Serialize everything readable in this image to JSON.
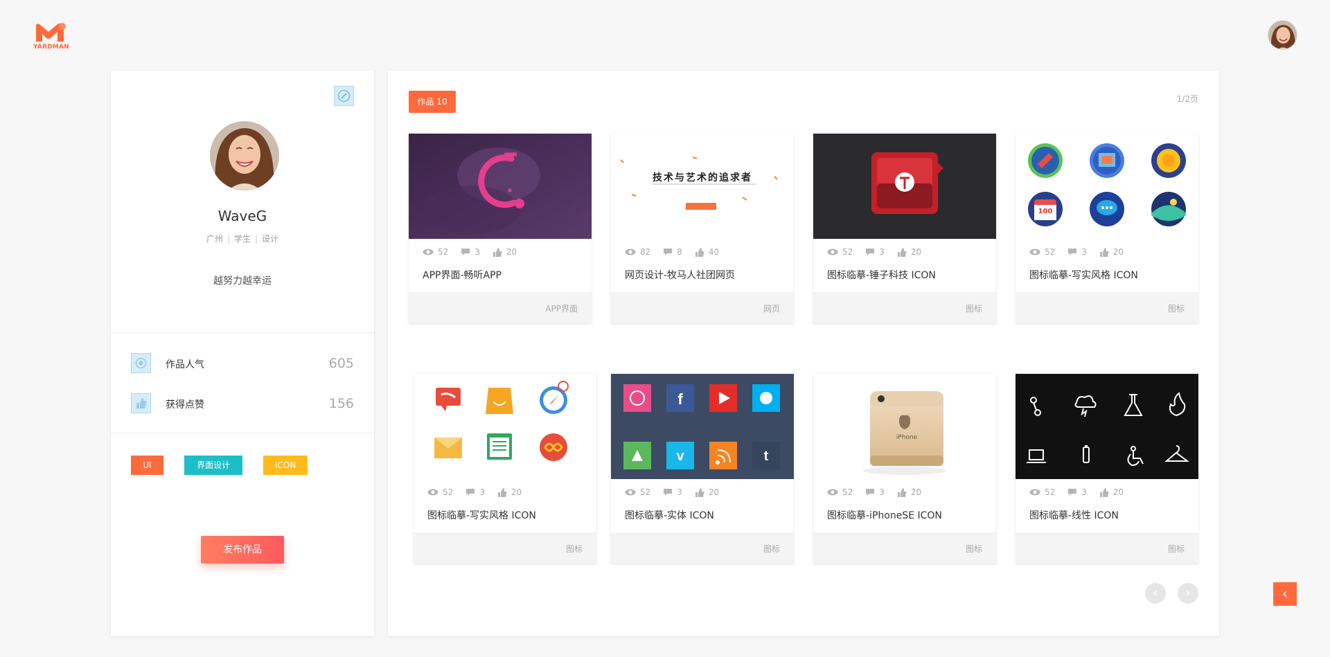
{
  "brand": {
    "logo_text": "YARDMAN",
    "accent": "#ff6a3d"
  },
  "profile": {
    "name": "WaveG",
    "meta": [
      "广州",
      "学生",
      "设计"
    ],
    "motto": "越努力越幸运",
    "stats": [
      {
        "label": "作品人气",
        "value": "605",
        "icon": "eye-icon"
      },
      {
        "label": "获得点赞",
        "value": "156",
        "icon": "thumb-up-icon"
      }
    ],
    "tags": [
      {
        "label": "UI",
        "color": "#ff6a3d"
      },
      {
        "label": "界面设计",
        "color": "#1cbfc8"
      },
      {
        "label": "ICON",
        "color": "#ffbb1c"
      }
    ],
    "publish_label": "发布作品"
  },
  "works": {
    "badge_label": "作品",
    "badge_count": "10",
    "page_indicator": "1/2页",
    "items": [
      {
        "title": "APP界面-畅听APP",
        "category": "APP界面",
        "views": "52",
        "comments": "3",
        "likes": "20"
      },
      {
        "title": "网页设计-牧马人社团网页",
        "category": "网页",
        "views": "82",
        "comments": "8",
        "likes": "40",
        "thumb_text": "技术与艺术的追求者"
      },
      {
        "title": "图标临摹-锤子科技 ICON",
        "category": "图标",
        "views": "52",
        "comments": "3",
        "likes": "20"
      },
      {
        "title": "图标临摹-写实风格 ICON",
        "category": "图标",
        "views": "52",
        "comments": "3",
        "likes": "20",
        "thumb_text": "100"
      },
      {
        "title": "图标临摹-写实风格 ICON",
        "category": "图标",
        "views": "52",
        "comments": "3",
        "likes": "20"
      },
      {
        "title": "图标临摹-实体 ICON",
        "category": "图标",
        "views": "52",
        "comments": "3",
        "likes": "20"
      },
      {
        "title": "图标临摹-iPhoneSE ICON",
        "category": "图标",
        "views": "52",
        "comments": "3",
        "likes": "20",
        "thumb_text": "iPhone"
      },
      {
        "title": "图标临摹-线性 ICON",
        "category": "图标",
        "views": "52",
        "comments": "3",
        "likes": "20"
      }
    ]
  },
  "pager": {
    "prev": "‹",
    "next": "›"
  },
  "back_glyph": "‹"
}
